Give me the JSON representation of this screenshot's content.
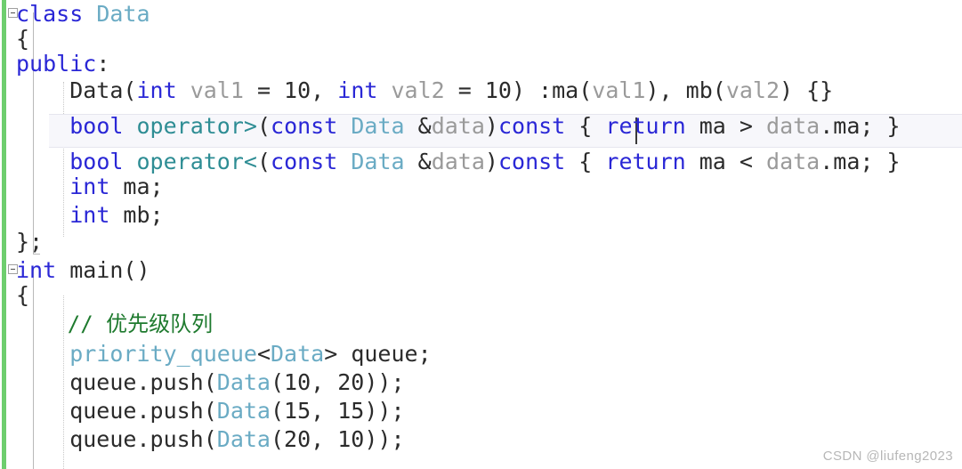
{
  "editor": {
    "language": "cpp",
    "colors": {
      "background": "#ffffff",
      "change_bar": "#6ece6e",
      "keyword": "#2a27d6",
      "type": "#6aabc4",
      "operator": "#2e8d94",
      "parameter": "#9a9a9a",
      "comment": "#1e7a2e",
      "plain_text": "#2b2b2b",
      "current_line_highlight": "#f7f7fb",
      "watermark": "#b7b7b7"
    },
    "current_line_index": 4,
    "caret_line_index": 4
  },
  "lines": [
    {
      "index": 0,
      "text": "class Data",
      "fold_marker": "collapse",
      "tokens": [
        {
          "t": "class",
          "c": "kw"
        },
        {
          "t": " ",
          "c": "plain"
        },
        {
          "t": "Data",
          "c": "type"
        }
      ]
    },
    {
      "index": 1,
      "text": "{",
      "fold_marker": "none",
      "tokens": [
        {
          "t": "{",
          "c": "plain"
        }
      ]
    },
    {
      "index": 2,
      "text": "public:",
      "fold_marker": "none",
      "tokens": [
        {
          "t": "public",
          "c": "kw"
        },
        {
          "t": ":",
          "c": "plain"
        }
      ]
    },
    {
      "index": 3,
      "text": "    Data(int val1 = 10, int val2 = 10) :ma(val1), mb(val2) {}",
      "fold_marker": "none",
      "tokens": [
        {
          "t": "    Data(",
          "c": "plain"
        },
        {
          "t": "int",
          "c": "kw"
        },
        {
          "t": " ",
          "c": "plain"
        },
        {
          "t": "val1",
          "c": "param"
        },
        {
          "t": " = 10, ",
          "c": "plain"
        },
        {
          "t": "int",
          "c": "kw"
        },
        {
          "t": " ",
          "c": "plain"
        },
        {
          "t": "val2",
          "c": "param"
        },
        {
          "t": " = 10) :ma(",
          "c": "plain"
        },
        {
          "t": "val1",
          "c": "param"
        },
        {
          "t": "), mb(",
          "c": "plain"
        },
        {
          "t": "val2",
          "c": "param"
        },
        {
          "t": ") {}",
          "c": "plain"
        }
      ]
    },
    {
      "index": 4,
      "text": "    bool operator>(const Data &data)const { return ma > data.ma; }",
      "fold_marker": "none",
      "tokens": [
        {
          "t": "    ",
          "c": "plain"
        },
        {
          "t": "bool",
          "c": "kw"
        },
        {
          "t": " ",
          "c": "plain"
        },
        {
          "t": "operator>",
          "c": "op"
        },
        {
          "t": "(",
          "c": "plain"
        },
        {
          "t": "const",
          "c": "kw"
        },
        {
          "t": " ",
          "c": "plain"
        },
        {
          "t": "Data",
          "c": "type"
        },
        {
          "t": " &",
          "c": "plain"
        },
        {
          "t": "data",
          "c": "param"
        },
        {
          "t": ")",
          "c": "plain"
        },
        {
          "t": "const",
          "c": "kw"
        },
        {
          "t": " { ",
          "c": "plain"
        },
        {
          "t": "return",
          "c": "kw"
        },
        {
          "t": " ma > ",
          "c": "plain"
        },
        {
          "t": "data",
          "c": "param"
        },
        {
          "t": ".ma; }",
          "c": "plain"
        }
      ]
    },
    {
      "index": 5,
      "text": "    bool operator<(const Data &data)const { return ma < data.ma; }",
      "fold_marker": "none",
      "tokens": [
        {
          "t": "    ",
          "c": "plain"
        },
        {
          "t": "bool",
          "c": "kw"
        },
        {
          "t": " ",
          "c": "plain"
        },
        {
          "t": "operator<",
          "c": "op"
        },
        {
          "t": "(",
          "c": "plain"
        },
        {
          "t": "const",
          "c": "kw"
        },
        {
          "t": " ",
          "c": "plain"
        },
        {
          "t": "Data",
          "c": "type"
        },
        {
          "t": " &",
          "c": "plain"
        },
        {
          "t": "data",
          "c": "param"
        },
        {
          "t": ")",
          "c": "plain"
        },
        {
          "t": "const",
          "c": "kw"
        },
        {
          "t": " { ",
          "c": "plain"
        },
        {
          "t": "return",
          "c": "kw"
        },
        {
          "t": " ma < ",
          "c": "plain"
        },
        {
          "t": "data",
          "c": "param"
        },
        {
          "t": ".ma; }",
          "c": "plain"
        }
      ]
    },
    {
      "index": 6,
      "text": "    int ma;",
      "fold_marker": "none",
      "tokens": [
        {
          "t": "    ",
          "c": "plain"
        },
        {
          "t": "int",
          "c": "kw"
        },
        {
          "t": " ma;",
          "c": "plain"
        }
      ]
    },
    {
      "index": 7,
      "text": "    int mb;",
      "fold_marker": "none",
      "tokens": [
        {
          "t": "    ",
          "c": "plain"
        },
        {
          "t": "int",
          "c": "kw"
        },
        {
          "t": " mb;",
          "c": "plain"
        }
      ]
    },
    {
      "index": 8,
      "text": "};",
      "fold_marker": "none",
      "tokens": [
        {
          "t": "};",
          "c": "plain"
        }
      ]
    },
    {
      "index": 9,
      "text": "int main()",
      "fold_marker": "collapse",
      "tokens": [
        {
          "t": "int",
          "c": "kw"
        },
        {
          "t": " main()",
          "c": "plain"
        }
      ]
    },
    {
      "index": 10,
      "text": "{",
      "fold_marker": "none",
      "tokens": [
        {
          "t": "{",
          "c": "plain"
        }
      ]
    },
    {
      "index": 11,
      "text": "    // 优先级队列",
      "fold_marker": "none",
      "tokens": [
        {
          "t": "    ",
          "c": "plain"
        },
        {
          "t": "// ",
          "c": "comment"
        },
        {
          "t": "优先级队列",
          "c": "comment cjk"
        }
      ]
    },
    {
      "index": 12,
      "text": "    priority_queue<Data> queue;",
      "fold_marker": "none",
      "tokens": [
        {
          "t": "    ",
          "c": "plain"
        },
        {
          "t": "priority_queue",
          "c": "type"
        },
        {
          "t": "<",
          "c": "plain"
        },
        {
          "t": "Data",
          "c": "type"
        },
        {
          "t": "> queue;",
          "c": "plain"
        }
      ]
    },
    {
      "index": 13,
      "text": "    queue.push(Data(10, 20));",
      "fold_marker": "none",
      "tokens": [
        {
          "t": "    queue.push(",
          "c": "plain"
        },
        {
          "t": "Data",
          "c": "type"
        },
        {
          "t": "(10, 20));",
          "c": "plain"
        }
      ]
    },
    {
      "index": 14,
      "text": "    queue.push(Data(15, 15));",
      "fold_marker": "none",
      "tokens": [
        {
          "t": "    queue.push(",
          "c": "plain"
        },
        {
          "t": "Data",
          "c": "type"
        },
        {
          "t": "(15, 15));",
          "c": "plain"
        }
      ]
    },
    {
      "index": 15,
      "text": "    queue.push(Data(20, 10));",
      "fold_marker": "none",
      "tokens": [
        {
          "t": "    queue.push(",
          "c": "plain"
        },
        {
          "t": "Data",
          "c": "type"
        },
        {
          "t": "(20, 10));",
          "c": "plain"
        }
      ]
    }
  ],
  "watermark": {
    "text": "CSDN @liufeng2023"
  }
}
